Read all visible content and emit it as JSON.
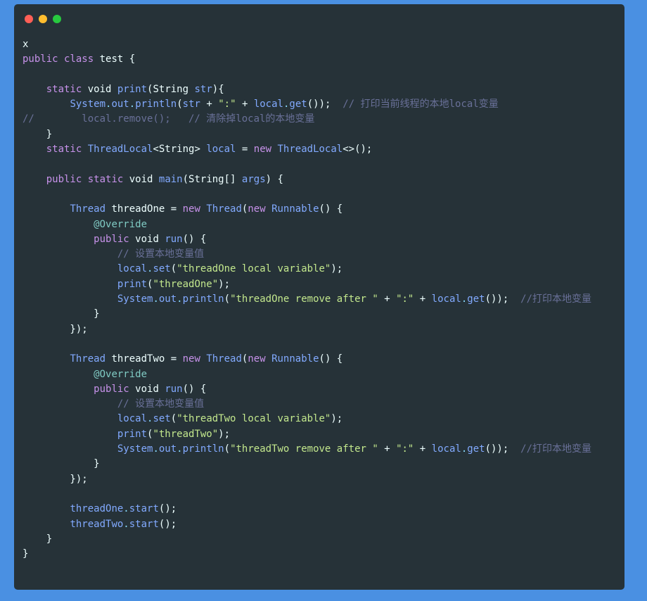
{
  "window_controls": {
    "close_color": "#ff5f56",
    "minimize_color": "#ffbd2e",
    "maximize_color": "#27c93f"
  },
  "code_lines": [
    [
      {
        "t": "x",
        "c": "pl"
      }
    ],
    [
      {
        "t": "public",
        "c": "kw"
      },
      {
        "t": " ",
        "c": "pl"
      },
      {
        "t": "class",
        "c": "kw"
      },
      {
        "t": " test {",
        "c": "pl"
      }
    ],
    [],
    [
      {
        "t": "    ",
        "c": "pl"
      },
      {
        "t": "static",
        "c": "kw"
      },
      {
        "t": " void ",
        "c": "pl"
      },
      {
        "t": "print",
        "c": "fn"
      },
      {
        "t": "(String ",
        "c": "pl"
      },
      {
        "t": "str",
        "c": "ty"
      },
      {
        "t": "){",
        "c": "pl"
      }
    ],
    [
      {
        "t": "        ",
        "c": "pl"
      },
      {
        "t": "System",
        "c": "ty"
      },
      {
        "t": ".",
        "c": "op"
      },
      {
        "t": "out",
        "c": "ty"
      },
      {
        "t": ".",
        "c": "op"
      },
      {
        "t": "println",
        "c": "fn"
      },
      {
        "t": "(",
        "c": "pl"
      },
      {
        "t": "str",
        "c": "ty"
      },
      {
        "t": " + ",
        "c": "pl"
      },
      {
        "t": "\":\"",
        "c": "st"
      },
      {
        "t": " + ",
        "c": "pl"
      },
      {
        "t": "local",
        "c": "ty"
      },
      {
        "t": ".",
        "c": "op"
      },
      {
        "t": "get",
        "c": "fn"
      },
      {
        "t": "());  ",
        "c": "pl"
      },
      {
        "t": "// 打印当前线程的本地local变量",
        "c": "cm"
      }
    ],
    [
      {
        "t": "//        local.remove();   // 清除掉local的本地变量",
        "c": "cm"
      }
    ],
    [
      {
        "t": "    }",
        "c": "pl"
      }
    ],
    [
      {
        "t": "    ",
        "c": "pl"
      },
      {
        "t": "static",
        "c": "kw"
      },
      {
        "t": " ",
        "c": "pl"
      },
      {
        "t": "ThreadLocal",
        "c": "ty"
      },
      {
        "t": "<String> ",
        "c": "pl"
      },
      {
        "t": "local",
        "c": "ty"
      },
      {
        "t": " = ",
        "c": "pl"
      },
      {
        "t": "new",
        "c": "kw"
      },
      {
        "t": " ",
        "c": "pl"
      },
      {
        "t": "ThreadLocal",
        "c": "ty"
      },
      {
        "t": "<>();",
        "c": "pl"
      }
    ],
    [],
    [
      {
        "t": "    ",
        "c": "pl"
      },
      {
        "t": "public",
        "c": "kw"
      },
      {
        "t": " ",
        "c": "pl"
      },
      {
        "t": "static",
        "c": "kw"
      },
      {
        "t": " void ",
        "c": "pl"
      },
      {
        "t": "main",
        "c": "fn"
      },
      {
        "t": "(String[] ",
        "c": "pl"
      },
      {
        "t": "args",
        "c": "ty"
      },
      {
        "t": ") {",
        "c": "pl"
      }
    ],
    [],
    [
      {
        "t": "        ",
        "c": "pl"
      },
      {
        "t": "Thread",
        "c": "ty"
      },
      {
        "t": " threadOne = ",
        "c": "pl"
      },
      {
        "t": "new",
        "c": "kw"
      },
      {
        "t": " ",
        "c": "pl"
      },
      {
        "t": "Thread",
        "c": "ty"
      },
      {
        "t": "(",
        "c": "pl"
      },
      {
        "t": "new",
        "c": "kw"
      },
      {
        "t": " ",
        "c": "pl"
      },
      {
        "t": "Runnable",
        "c": "ty"
      },
      {
        "t": "() {",
        "c": "pl"
      }
    ],
    [
      {
        "t": "            ",
        "c": "pl"
      },
      {
        "t": "@Override",
        "c": "an"
      }
    ],
    [
      {
        "t": "            ",
        "c": "pl"
      },
      {
        "t": "public",
        "c": "kw"
      },
      {
        "t": " void ",
        "c": "pl"
      },
      {
        "t": "run",
        "c": "fn"
      },
      {
        "t": "() {",
        "c": "pl"
      }
    ],
    [
      {
        "t": "                ",
        "c": "pl"
      },
      {
        "t": "// 设置本地变量值",
        "c": "cm"
      }
    ],
    [
      {
        "t": "                ",
        "c": "pl"
      },
      {
        "t": "local",
        "c": "ty"
      },
      {
        "t": ".",
        "c": "op"
      },
      {
        "t": "set",
        "c": "fn"
      },
      {
        "t": "(",
        "c": "pl"
      },
      {
        "t": "\"threadOne local variable\"",
        "c": "st"
      },
      {
        "t": ");",
        "c": "pl"
      }
    ],
    [
      {
        "t": "                ",
        "c": "pl"
      },
      {
        "t": "print",
        "c": "fn"
      },
      {
        "t": "(",
        "c": "pl"
      },
      {
        "t": "\"threadOne\"",
        "c": "st"
      },
      {
        "t": ");",
        "c": "pl"
      }
    ],
    [
      {
        "t": "                ",
        "c": "pl"
      },
      {
        "t": "System",
        "c": "ty"
      },
      {
        "t": ".",
        "c": "op"
      },
      {
        "t": "out",
        "c": "ty"
      },
      {
        "t": ".",
        "c": "op"
      },
      {
        "t": "println",
        "c": "fn"
      },
      {
        "t": "(",
        "c": "pl"
      },
      {
        "t": "\"threadOne remove after \"",
        "c": "st"
      },
      {
        "t": " + ",
        "c": "pl"
      },
      {
        "t": "\":\"",
        "c": "st"
      },
      {
        "t": " + ",
        "c": "pl"
      },
      {
        "t": "local",
        "c": "ty"
      },
      {
        "t": ".",
        "c": "op"
      },
      {
        "t": "get",
        "c": "fn"
      },
      {
        "t": "());  ",
        "c": "pl"
      },
      {
        "t": "//打印本地变量",
        "c": "cm"
      }
    ],
    [
      {
        "t": "            }",
        "c": "pl"
      }
    ],
    [
      {
        "t": "        });",
        "c": "pl"
      }
    ],
    [],
    [
      {
        "t": "        ",
        "c": "pl"
      },
      {
        "t": "Thread",
        "c": "ty"
      },
      {
        "t": " threadTwo = ",
        "c": "pl"
      },
      {
        "t": "new",
        "c": "kw"
      },
      {
        "t": " ",
        "c": "pl"
      },
      {
        "t": "Thread",
        "c": "ty"
      },
      {
        "t": "(",
        "c": "pl"
      },
      {
        "t": "new",
        "c": "kw"
      },
      {
        "t": " ",
        "c": "pl"
      },
      {
        "t": "Runnable",
        "c": "ty"
      },
      {
        "t": "() {",
        "c": "pl"
      }
    ],
    [
      {
        "t": "            ",
        "c": "pl"
      },
      {
        "t": "@Override",
        "c": "an"
      }
    ],
    [
      {
        "t": "            ",
        "c": "pl"
      },
      {
        "t": "public",
        "c": "kw"
      },
      {
        "t": " void ",
        "c": "pl"
      },
      {
        "t": "run",
        "c": "fn"
      },
      {
        "t": "() {",
        "c": "pl"
      }
    ],
    [
      {
        "t": "                ",
        "c": "pl"
      },
      {
        "t": "// 设置本地变量值",
        "c": "cm"
      }
    ],
    [
      {
        "t": "                ",
        "c": "pl"
      },
      {
        "t": "local",
        "c": "ty"
      },
      {
        "t": ".",
        "c": "op"
      },
      {
        "t": "set",
        "c": "fn"
      },
      {
        "t": "(",
        "c": "pl"
      },
      {
        "t": "\"threadTwo local variable\"",
        "c": "st"
      },
      {
        "t": ");",
        "c": "pl"
      }
    ],
    [
      {
        "t": "                ",
        "c": "pl"
      },
      {
        "t": "print",
        "c": "fn"
      },
      {
        "t": "(",
        "c": "pl"
      },
      {
        "t": "\"threadTwo\"",
        "c": "st"
      },
      {
        "t": ");",
        "c": "pl"
      }
    ],
    [
      {
        "t": "                ",
        "c": "pl"
      },
      {
        "t": "System",
        "c": "ty"
      },
      {
        "t": ".",
        "c": "op"
      },
      {
        "t": "out",
        "c": "ty"
      },
      {
        "t": ".",
        "c": "op"
      },
      {
        "t": "println",
        "c": "fn"
      },
      {
        "t": "(",
        "c": "pl"
      },
      {
        "t": "\"threadTwo remove after \"",
        "c": "st"
      },
      {
        "t": " + ",
        "c": "pl"
      },
      {
        "t": "\":\"",
        "c": "st"
      },
      {
        "t": " + ",
        "c": "pl"
      },
      {
        "t": "local",
        "c": "ty"
      },
      {
        "t": ".",
        "c": "op"
      },
      {
        "t": "get",
        "c": "fn"
      },
      {
        "t": "());  ",
        "c": "pl"
      },
      {
        "t": "//打印本地变量",
        "c": "cm"
      }
    ],
    [
      {
        "t": "            }",
        "c": "pl"
      }
    ],
    [
      {
        "t": "        });",
        "c": "pl"
      }
    ],
    [],
    [
      {
        "t": "        ",
        "c": "pl"
      },
      {
        "t": "threadOne",
        "c": "ty"
      },
      {
        "t": ".",
        "c": "op"
      },
      {
        "t": "start",
        "c": "fn"
      },
      {
        "t": "();",
        "c": "pl"
      }
    ],
    [
      {
        "t": "        ",
        "c": "pl"
      },
      {
        "t": "threadTwo",
        "c": "ty"
      },
      {
        "t": ".",
        "c": "op"
      },
      {
        "t": "start",
        "c": "fn"
      },
      {
        "t": "();",
        "c": "pl"
      }
    ],
    [
      {
        "t": "    }",
        "c": "pl"
      }
    ],
    [
      {
        "t": "}",
        "c": "pl"
      }
    ]
  ]
}
